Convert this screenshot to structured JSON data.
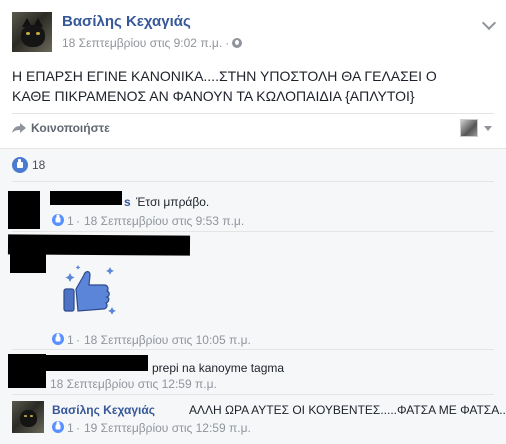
{
  "post": {
    "author": "Βασίλης Κεχαγιάς",
    "timestamp": "18 Σεπτεμβρίου στις 9:02 π.μ.",
    "separator": "·",
    "text": "Η ΕΠΑΡΣΗ ΕΓΙΝΕ ΚΑΝΟΝΙΚΑ....ΣΤΗΝ ΥΠΟΣΤΟΛΗ ΘΑ ΓΕΛΑΣΕΙ Ο ΚΑΘΕ ΠΙΚΡΑΜΕΝΟΣ ΑΝ ΦΑΝΟΥΝ ΤΑ ΚΩΛΟΠΑΙΔΙΑ {ΑΠΛΥΤΟΙ}",
    "share_label": "Κοινοποιήστε",
    "like_count": "18"
  },
  "comments": [
    {
      "name_suffix": "s",
      "text": "Έτσι μπράβο.",
      "likes": "1",
      "timestamp": "18 Σεπτεμβρίου στις 9:53 π.μ."
    },
    {
      "sticker": "thumbs-up-sticker",
      "likes": "1",
      "timestamp": "18 Σεπτεμβρίου στις 10:05 π.μ."
    },
    {
      "text": "prepi na kanoyme tagma",
      "timestamp": "18 Σεπτεμβρίου στις 12:59 π.μ."
    },
    {
      "author": "Βασίλης Κεχαγιάς",
      "text": "ΑΛΛΗ ΩΡΑ ΑΥΤΕΣ ΟΙ ΚΟΥΒΕΝΤΕΣ.....ΦΑΤΣΑ ΜΕ ΦΑΤΣΑ...",
      "likes": "1",
      "timestamp": "19 Σεπτεμβρίου στις 12:59 π.μ."
    }
  ],
  "common": {
    "dot": "·"
  },
  "colors": {
    "link": "#365899",
    "meta": "#90949c",
    "like": "#5890ff",
    "redaction": "#000000"
  }
}
